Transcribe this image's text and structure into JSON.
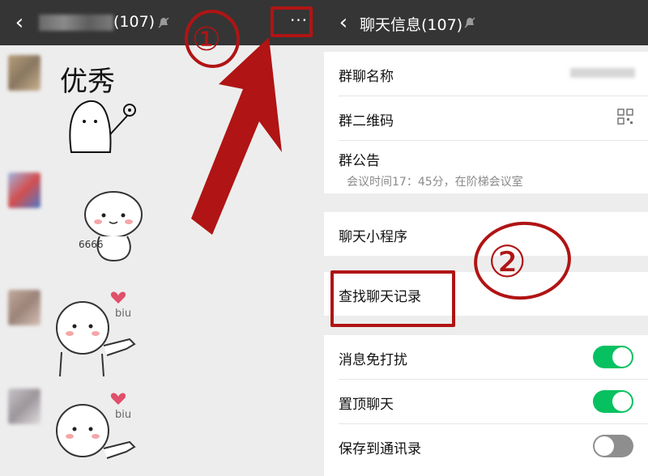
{
  "left": {
    "header": {
      "count": "(107)"
    },
    "stickers": [
      {
        "caption": "优秀"
      },
      {
        "caption": ""
      },
      {
        "caption": "biu"
      },
      {
        "caption": "biu"
      }
    ]
  },
  "right": {
    "header": {
      "title": "聊天信息(107)"
    },
    "settings": {
      "group_name_label": "群聊名称",
      "qr_label": "群二维码",
      "notice_label": "群公告",
      "notice_text": "会议时间17：45分，在阶梯会议室",
      "mini_program_label": "聊天小程序",
      "search_history_label": "查找聊天记录",
      "mute_label": "消息免打扰",
      "mute_on": true,
      "pin_label": "置顶聊天",
      "pin_on": true,
      "save_contacts_label": "保存到通讯录",
      "save_contacts_on": false
    }
  },
  "annotations": {
    "step1": "①",
    "step2": "②",
    "color": "#b01414"
  }
}
